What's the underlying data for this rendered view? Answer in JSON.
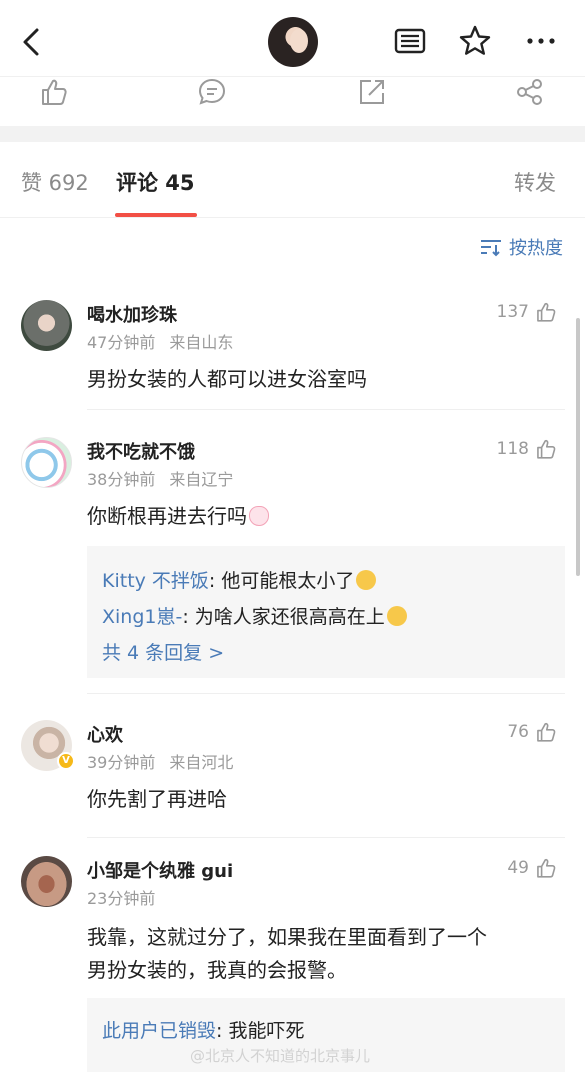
{
  "tabs": {
    "likes": "赞 692",
    "comments": "评论 45",
    "repost": "转发"
  },
  "sort": {
    "label": "按热度"
  },
  "comments": [
    {
      "name": "喝水加珍珠",
      "time": "47分钟前",
      "location": "来自山东",
      "likes": "137",
      "text": "男扮女装的人都可以进女浴室吗"
    },
    {
      "name": "我不吃就不饿",
      "time": "38分钟前",
      "location": "来自辽宁",
      "likes": "118",
      "text": "你断根再进去行吗",
      "replies": [
        {
          "name": "Kitty 不拌饭",
          "text": ": 他可能根太小了"
        },
        {
          "name": "Xing1崽-",
          "text": ": 为啥人家还很高高在上"
        }
      ],
      "more_replies": "共 4 条回复 >"
    },
    {
      "name": "心欢",
      "time": "39分钟前",
      "location": "来自河北",
      "likes": "76",
      "text": "你先割了再进哈"
    },
    {
      "name": "小邹是个纨雅 gui",
      "time": "23分钟前",
      "location": "",
      "likes": "49",
      "text_line1": "我靠，这就过分了，如果我在里面看到了一个",
      "text_line2": "男扮女装的，我真的会报警。",
      "replies": [
        {
          "name": "此用户已销毁",
          "text": ": 我能吓死"
        }
      ]
    }
  ],
  "watermark": "@北京人不知道的北京事儿",
  "icons": {
    "back": "back-arrow-icon",
    "article": "article-icon",
    "star": "star-icon",
    "more": "more-icon",
    "like": "thumbs-up-icon",
    "comment": "comment-icon",
    "share": "share-icon",
    "forward": "forward-icon",
    "sort": "sort-icon"
  },
  "colors": {
    "accent": "#f24f45",
    "link": "#4a7bb7",
    "meta": "#9a9a9a"
  }
}
